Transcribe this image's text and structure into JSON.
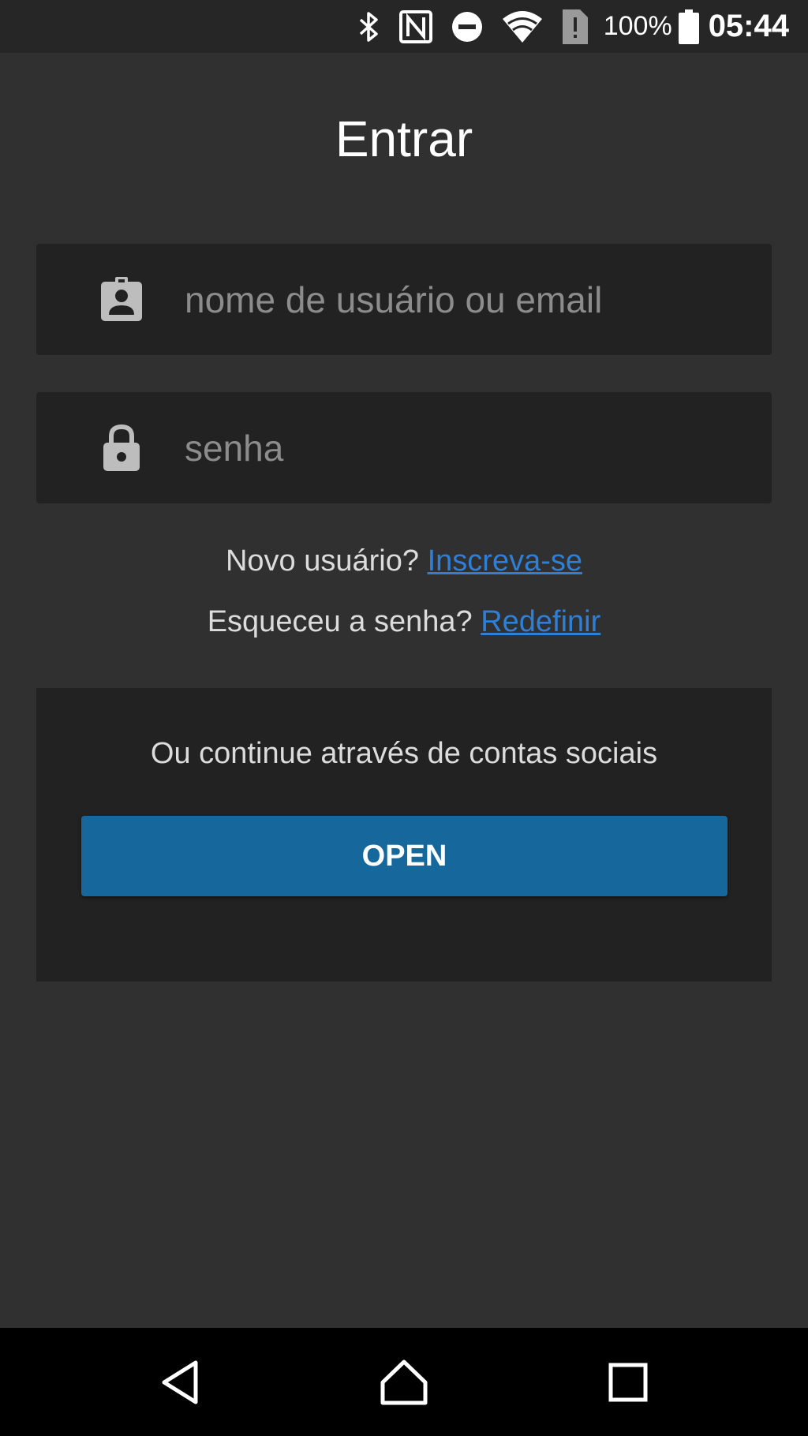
{
  "status_bar": {
    "icons": [
      "bluetooth-icon",
      "nfc-icon",
      "do-not-disturb-icon",
      "wifi-icon",
      "sim-alert-icon",
      "battery-icon"
    ],
    "battery_percent": "100%",
    "time": "05:44"
  },
  "login": {
    "title": "Entrar",
    "username": {
      "placeholder": "nome de usuário ou email",
      "value": "",
      "icon": "contact-badge-icon"
    },
    "password": {
      "placeholder": "senha",
      "value": "",
      "icon": "lock-icon"
    },
    "signup": {
      "prompt": "Novo usuário?",
      "link": "Inscreva-se"
    },
    "reset": {
      "prompt": "Esqueceu a senha?",
      "link": "Redefinir"
    },
    "social": {
      "text": "Ou continue através de contas sociais",
      "button_label": "OPEN"
    }
  },
  "nav_bar": {
    "icons": [
      "back-icon",
      "home-icon",
      "recents-icon"
    ]
  },
  "colors": {
    "background": "#303030",
    "field_background": "#222222",
    "link": "#2f7fd6",
    "button": "#16679c",
    "status_bar": "#262626",
    "nav_bar": "#000000"
  }
}
